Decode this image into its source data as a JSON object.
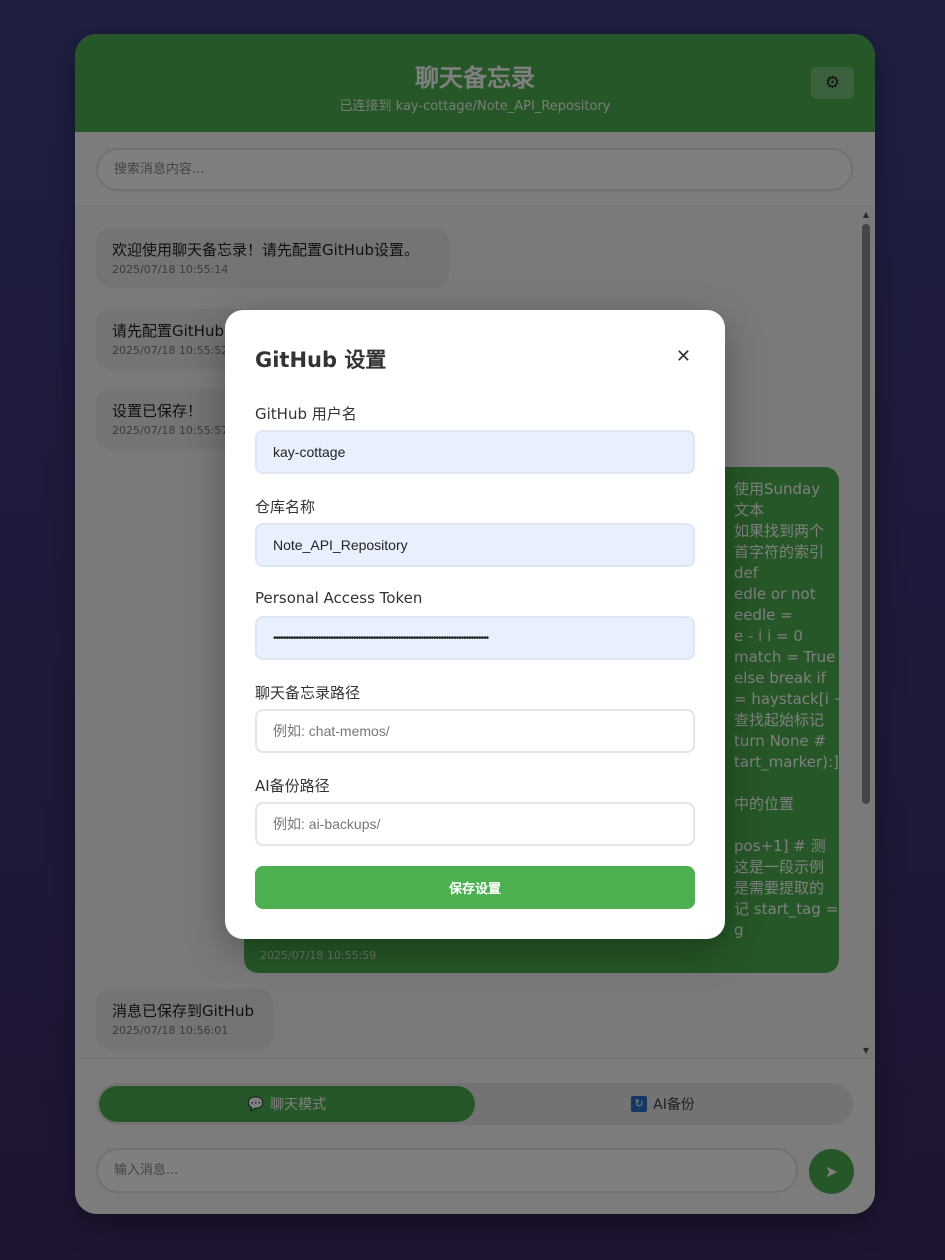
{
  "header": {
    "title": "聊天备忘录",
    "subtitle": "已连接到 kay-cottage/Note_API_Repository",
    "settings_icon": "gear-icon"
  },
  "search": {
    "placeholder": "搜索消息内容..."
  },
  "messages": [
    {
      "type": "system",
      "text": "欢迎使用聊天备忘录！请先配置GitHub设置。",
      "time": "2025/07/18 10:55:14"
    },
    {
      "type": "system",
      "text": "请先配置GitHub",
      "time": "2025/07/18 10:55:52"
    },
    {
      "type": "system",
      "text": "设置已保存！",
      "time": "2025/07/18 10:55:57"
    },
    {
      "type": "user",
      "lines": [
        "使用Sunday",
        "文本",
        "如果找到两个",
        "首字符的索引",
        "def",
        "edle or not",
        "eedle =",
        "e - i i = 0",
        "match = True",
        "else break if",
        "= haystack[i +",
        "查找起始标记",
        "turn None #",
        "tart_marker):]",
        "",
        "中的位置",
        "",
        "pos+1] # 测",
        "这是一段示例",
        "是需要提取的",
        "记 start_tag =",
        "g"
      ],
      "time": "2025/07/18 10:55:59"
    },
    {
      "type": "system",
      "text": "消息已保存到GitHub",
      "time": "2025/07/18 10:56:01"
    }
  ],
  "mode_tabs": {
    "chat_label": "聊天模式",
    "chat_icon": "chat-bubble-icon",
    "ai_label": "AI备份",
    "ai_icon": "refresh-icon"
  },
  "composer": {
    "placeholder": "输入消息...",
    "send_icon": "send-icon"
  },
  "modal": {
    "title": "GitHub 设置",
    "close_icon": "close-icon",
    "fields": {
      "username_label": "GitHub 用户名",
      "username_value": "kay-cottage",
      "repo_label": "仓库名称",
      "repo_value": "Note_API_Repository",
      "token_label": "Personal Access Token",
      "token_value": "••••••••••••••••••••••••••••••••••••••••••••••••••••••••••••••••••••••••••••••••••••••",
      "memo_path_label": "聊天备忘录路径",
      "memo_path_placeholder": "例如: chat-memos/",
      "ai_path_label": "AI备份路径",
      "ai_path_placeholder": "例如: ai-backups/"
    },
    "save_label": "保存设置"
  },
  "colors": {
    "accent": "#4caf50",
    "background_top": "#3d3f84",
    "background_bottom": "#3e2a64"
  }
}
